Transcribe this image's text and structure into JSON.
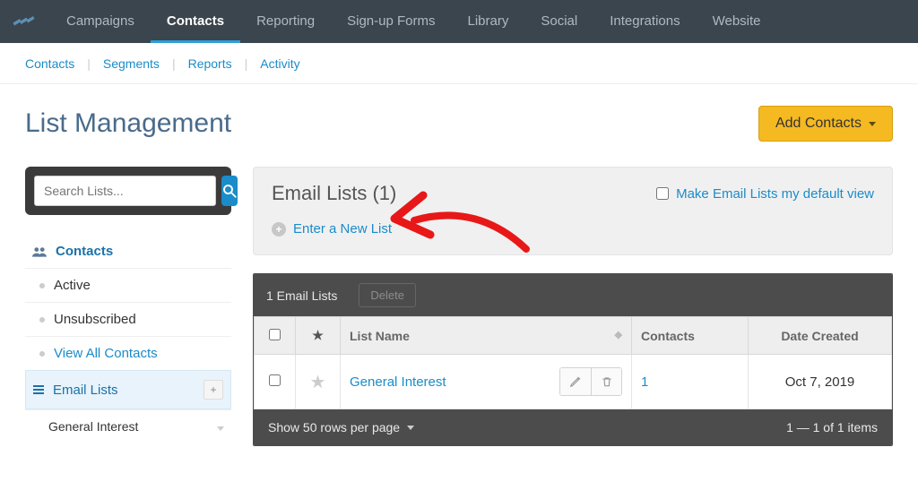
{
  "topnav": {
    "items": [
      "Campaigns",
      "Contacts",
      "Reporting",
      "Sign-up Forms",
      "Library",
      "Social",
      "Integrations",
      "Website"
    ],
    "active": "Contacts"
  },
  "subnav": {
    "items": [
      "Contacts",
      "Segments",
      "Reports",
      "Activity"
    ]
  },
  "page": {
    "title": "List Management",
    "add_button": "Add Contacts"
  },
  "search": {
    "placeholder": "Search Lists..."
  },
  "sidebar": {
    "contacts_label": "Contacts",
    "items": [
      {
        "label": "Active"
      },
      {
        "label": "Unsubscribed"
      },
      {
        "label": "View All Contacts",
        "link": true
      }
    ],
    "email_lists_label": "Email Lists",
    "child_list": "General Interest"
  },
  "panel": {
    "title": "Email Lists (1)",
    "default_view_label": "Make Email Lists my default view",
    "new_list_label": "Enter a New List",
    "bar_title": "1 Email Lists",
    "delete_label": "Delete"
  },
  "table": {
    "headers": {
      "name": "List Name",
      "contacts": "Contacts",
      "date": "Date Created"
    },
    "rows": [
      {
        "name": "General Interest",
        "contacts": "1",
        "date": "Oct 7, 2019"
      }
    ]
  },
  "footer": {
    "rows_per": "Show 50 rows per page",
    "range": "1 — 1 of 1 items"
  }
}
